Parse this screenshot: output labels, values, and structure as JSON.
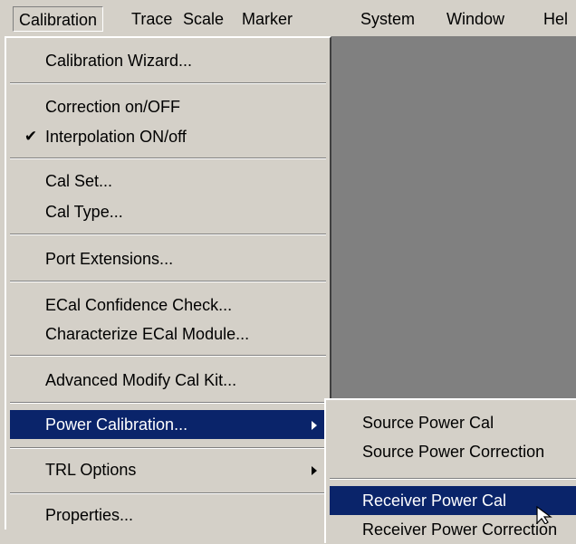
{
  "menubar": {
    "items": [
      "Calibration",
      "Trace",
      "Scale",
      "Marker",
      "System",
      "Window",
      "Hel"
    ]
  },
  "calibration_menu": {
    "calibration_wizard": "Calibration Wizard...",
    "correction": "Correction on/OFF",
    "interpolation": "Interpolation ON/off",
    "interpolation_checked": true,
    "cal_set": "Cal Set...",
    "cal_type": "Cal Type...",
    "port_extensions": "Port Extensions...",
    "ecal_confidence": "ECal Confidence Check...",
    "characterize_ecal": "Characterize ECal Module...",
    "advanced_modify": "Advanced Modify Cal Kit...",
    "power_calibration": "Power Calibration...",
    "trl_options": "TRL Options",
    "properties": "Properties..."
  },
  "power_submenu": {
    "source_power_cal": "Source Power Cal",
    "source_power_correction": "Source Power Correction",
    "receiver_power_cal": "Receiver Power Cal",
    "receiver_power_correction": "Receiver Power Correction"
  },
  "icons": {
    "check": "check-icon",
    "submenu_arrow": "submenu-arrow-icon",
    "cursor": "mouse-pointer-icon"
  },
  "colors": {
    "menu_bg": "#d4d0c8",
    "highlight": "#0a246a",
    "workspace": "#808080"
  }
}
